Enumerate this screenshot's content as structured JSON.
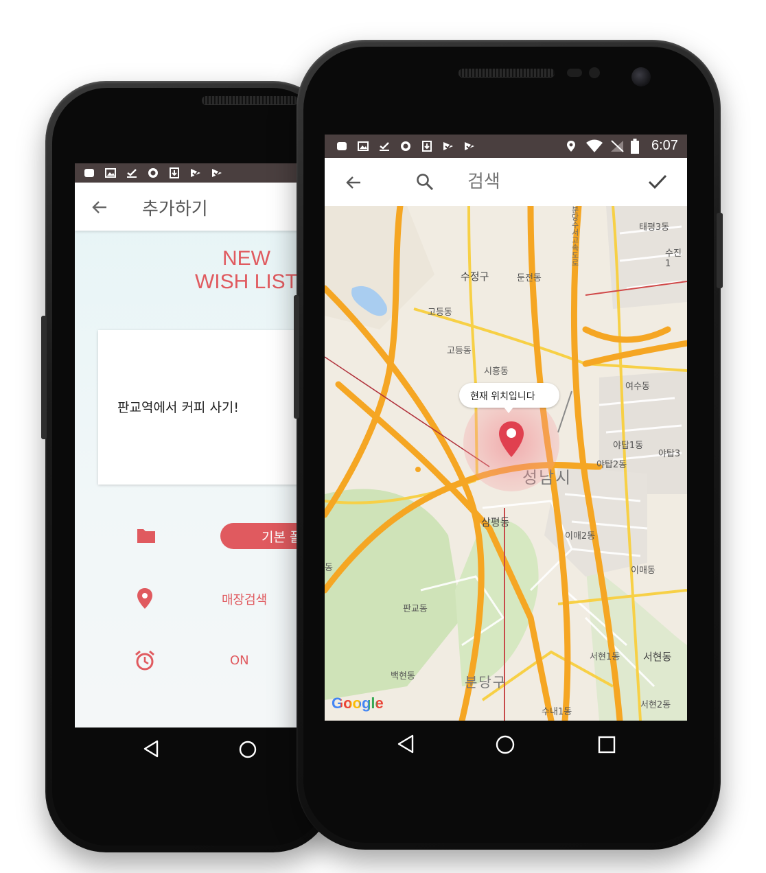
{
  "back_phone": {
    "toolbar": {
      "title": "추가하기"
    },
    "header": {
      "line1": "NEW",
      "line2": "WISH LIST"
    },
    "note_text": "판교역에서 커피 사기!",
    "folder": {
      "label": "기본 폴"
    },
    "location": {
      "label": "매장검색"
    },
    "alarm": {
      "label": "ON"
    }
  },
  "front_phone": {
    "status": {
      "time": "6:07"
    },
    "toolbar": {
      "search_placeholder": "검색"
    },
    "map": {
      "tooltip": "현재 위치입니다",
      "city_label": "성남시",
      "district_label": "분당구",
      "logo": "Google",
      "place_labels": [
        "태평3동",
        "수진1",
        "수정구",
        "둔전동",
        "고등동",
        "고등동",
        "시흥동",
        "여수동",
        "야탑1동",
        "야탑3",
        "야탑2동",
        "삼평동",
        "이매2동",
        "이매동",
        "판교동",
        "백현동",
        "서현1동",
        "서현동",
        "수내1동",
        "서현2동",
        "동"
      ],
      "road_label": "분당수서고속도로"
    }
  },
  "colors": {
    "accent": "#e05a5f",
    "statusbar": "#4a3f3f",
    "map_bg": "#f1ece2",
    "road": "#f5a623"
  }
}
